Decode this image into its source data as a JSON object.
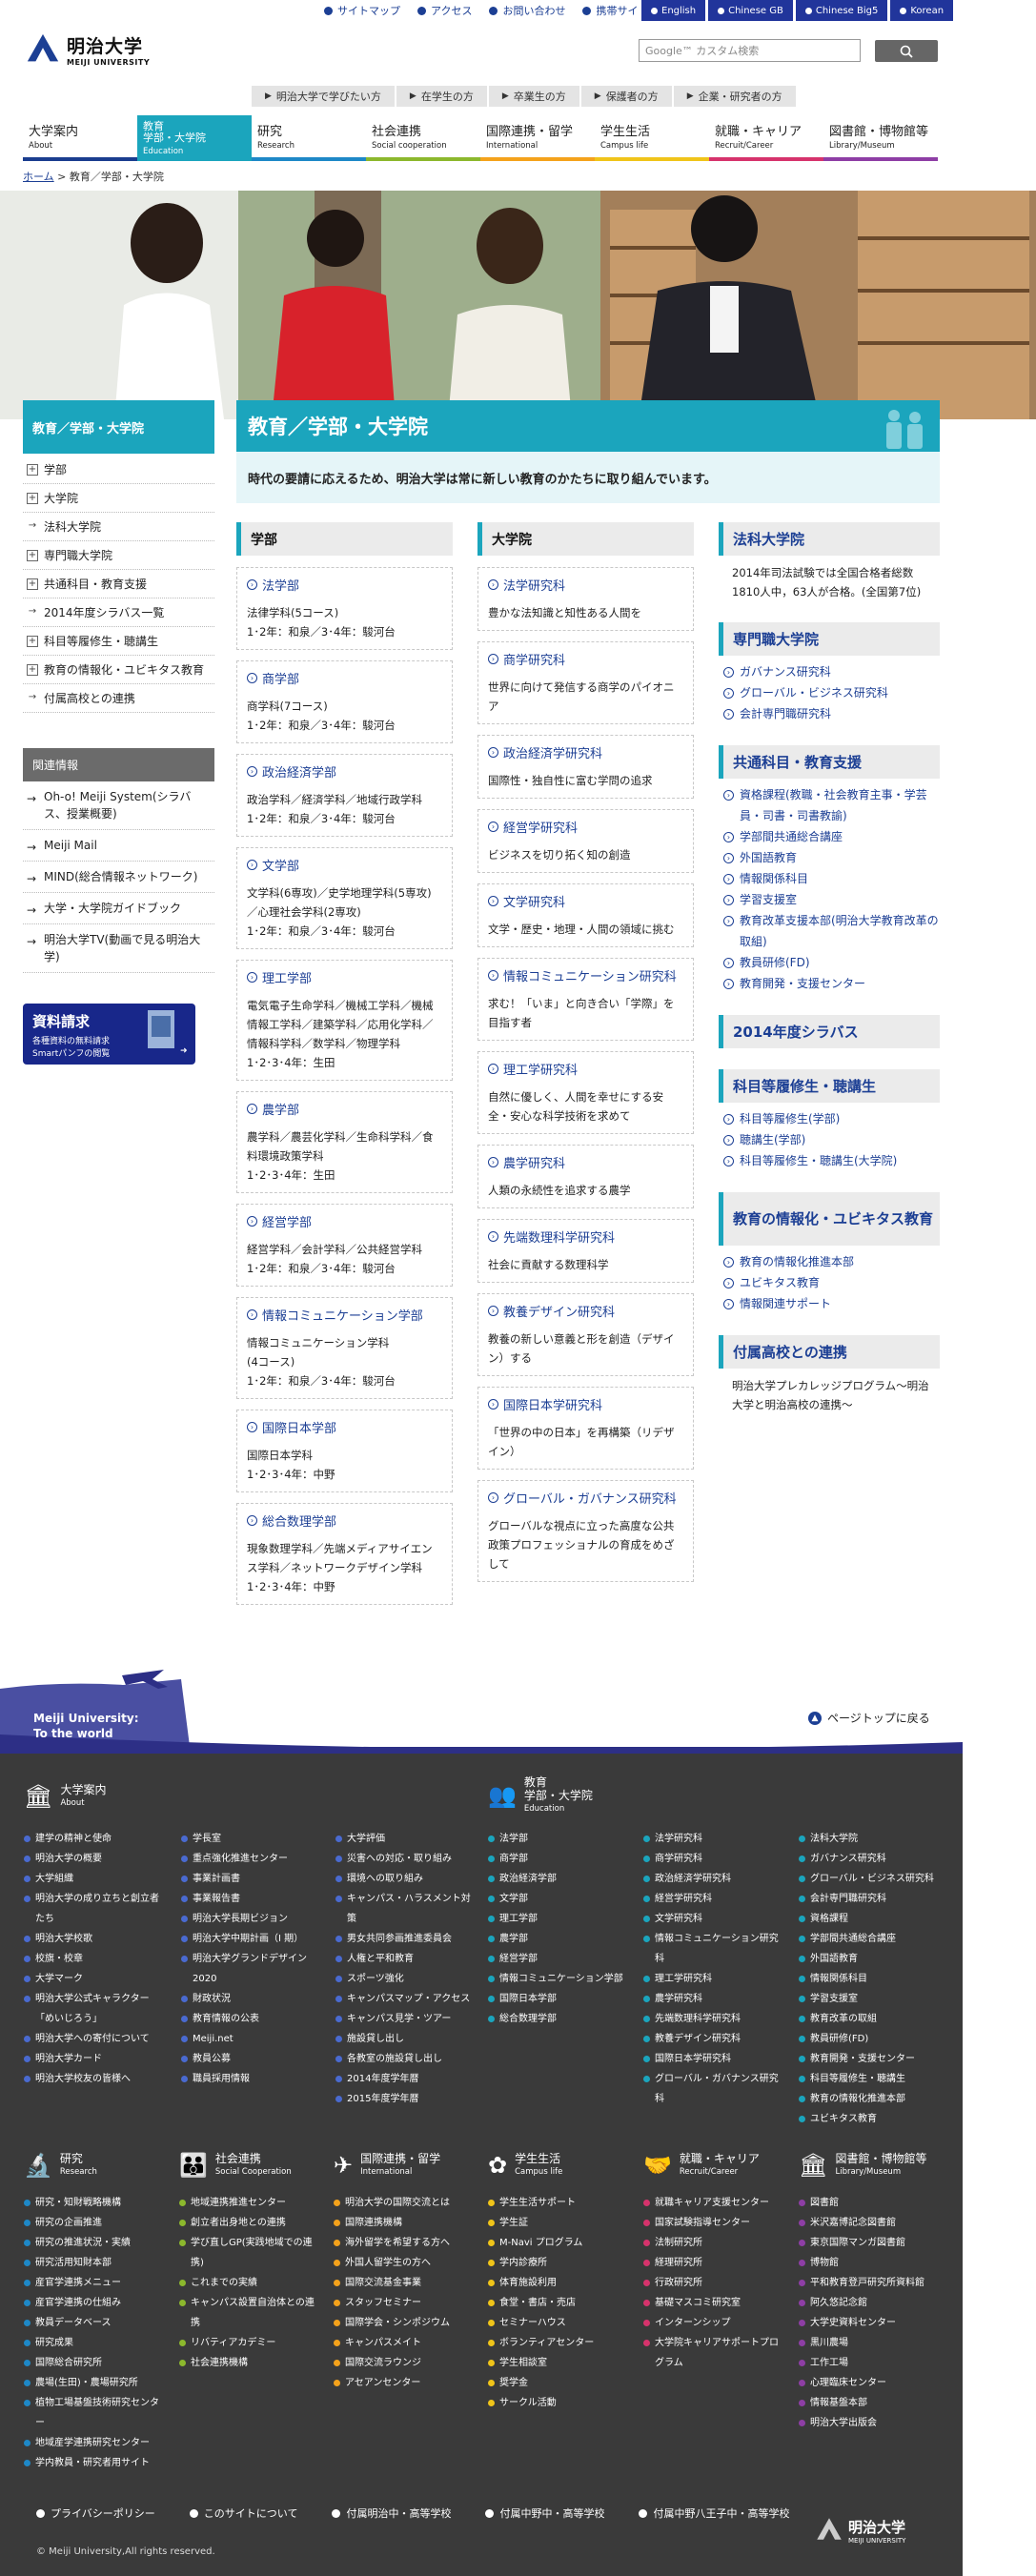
{
  "topbar": {
    "links": [
      "サイトマップ",
      "アクセス",
      "お問い合わせ",
      "携帯サイト"
    ],
    "langs": [
      "English",
      "Chinese GB",
      "Chinese Big5",
      "Korean"
    ]
  },
  "logo": {
    "ja": "明治大学",
    "en": "MEIJI UNIVERSITY"
  },
  "search": {
    "placeholder": "Google™ カスタム検索",
    "button": "検索"
  },
  "audience": [
    "明治大学で学びたい方",
    "在学生の方",
    "卒業生の方",
    "保護者の方",
    "企業・研究者の方"
  ],
  "gnav": [
    {
      "ja": "大学案内",
      "en": "About",
      "color": "#1a3d8f"
    },
    {
      "ja": "教育\n学部・大学院",
      "en": "Education",
      "color": "#1ba5bd"
    },
    {
      "ja": "研究",
      "en": "Research",
      "color": "#1e88c7"
    },
    {
      "ja": "社会連携",
      "en": "Social cooperation",
      "color": "#8cb82d"
    },
    {
      "ja": "国際連携・留学",
      "en": "International",
      "color": "#f4a21b"
    },
    {
      "ja": "学生生活",
      "en": "Campus life",
      "color": "#f0c419"
    },
    {
      "ja": "就職・キャリア",
      "en": "Recruit/Career",
      "color": "#d6336c"
    },
    {
      "ja": "図書館・博物館等",
      "en": "Library/Museum",
      "color": "#8e3ea5"
    }
  ],
  "breadcrumb": {
    "home": "ホーム",
    "current": "教育／学部・大学院"
  },
  "sidebar": {
    "title": "教育／学部・大学院",
    "items": [
      {
        "label": "学部",
        "icon": "plus"
      },
      {
        "label": "大学院",
        "icon": "plus"
      },
      {
        "label": "法科大学院",
        "icon": "arrow"
      },
      {
        "label": "専門職大学院",
        "icon": "plus"
      },
      {
        "label": "共通科目・教育支援",
        "icon": "plus"
      },
      {
        "label": "2014年度シラバス一覧",
        "icon": "arrow"
      },
      {
        "label": "科目等履修生・聴講生",
        "icon": "plus"
      },
      {
        "label": "教育の情報化・ユビキタス教育",
        "icon": "plus"
      },
      {
        "label": "付属高校との連携",
        "icon": "arrow"
      }
    ],
    "related_title": "関連情報",
    "related": [
      "Oh-o! Meiji System(シラバス、授業概要)",
      "Meiji Mail",
      "MIND(総合情報ネットワーク)",
      "大学・大学院ガイドブック",
      "明治大学TV(動画で見る明治大学)"
    ],
    "banner": {
      "title": "資料請求",
      "line1": "各種資料の無料請求",
      "line2": "Smartパンフの閲覧"
    }
  },
  "main": {
    "title": "教育／学部・大学院",
    "intro": "時代の要請に応えるため、明治大学は常に新しい教育のかたちに取り組んでいます。"
  },
  "faculties": {
    "heading": "学部",
    "items": [
      {
        "title": "法学部",
        "desc": "法律学科(5コース)\n1･2年：和泉／3･4年：駿河台"
      },
      {
        "title": "商学部",
        "desc": "商学科(7コース)\n1･2年：和泉／3･4年：駿河台"
      },
      {
        "title": "政治経済学部",
        "desc": "政治学科／経済学科／地域行政学科\n1･2年：和泉／3･4年：駿河台"
      },
      {
        "title": "文学部",
        "desc": "文学科(6専攻)／史学地理学科(5専攻)／心理社会学科(2専攻)\n1･2年：和泉／3･4年：駿河台"
      },
      {
        "title": "理工学部",
        "desc": "電気電子生命学科／機械工学科／機械情報工学科／建築学科／応用化学科／情報科学科／数学科／物理学科\n1･2･3･4年：生田"
      },
      {
        "title": "農学部",
        "desc": "農学科／農芸化学科／生命科学科／食料環境政策学科\n1･2･3･4年：生田"
      },
      {
        "title": "経営学部",
        "desc": "経営学科／会計学科／公共経営学科\n1･2年：和泉／3･4年：駿河台"
      },
      {
        "title": "情報コミュニケーション学部",
        "desc": "情報コミュニケーション学科\n(4コース)\n1･2年：和泉／3･4年：駿河台"
      },
      {
        "title": "国際日本学部",
        "desc": "国際日本学科\n1･2･3･4年：中野"
      },
      {
        "title": "総合数理学部",
        "desc": "現象数理学科／先端メディアサイエンス学科／ネットワークデザイン学科\n1･2･3･4年：中野"
      }
    ]
  },
  "graduate": {
    "heading": "大学院",
    "items": [
      {
        "title": "法学研究科",
        "desc": "豊かな法知識と知性ある人間を"
      },
      {
        "title": "商学研究科",
        "desc": "世界に向けて発信する商学のパイオニア"
      },
      {
        "title": "政治経済学研究科",
        "desc": "国際性・独自性に富む学問の追求"
      },
      {
        "title": "経営学研究科",
        "desc": "ビジネスを切り拓く知の創造"
      },
      {
        "title": "文学研究科",
        "desc": "文学・歴史・地理・人間の領域に挑む"
      },
      {
        "title": "情報コミュニケーション研究科",
        "desc": "求む！「いま」と向き合い「学際」を目指す者"
      },
      {
        "title": "理工学研究科",
        "desc": "自然に優しく、人間を幸せにする安全・安心な科学技術を求めて"
      },
      {
        "title": "農学研究科",
        "desc": "人類の永続性を追求する農学"
      },
      {
        "title": "先端数理科学研究科",
        "desc": "社会に貢献する数理科学"
      },
      {
        "title": "教養デザイン研究科",
        "desc": "教養の新しい意義と形を創造（デザイン）する"
      },
      {
        "title": "国際日本学研究科",
        "desc": "「世界の中の日本」を再構築（リデザイン）"
      },
      {
        "title": "グローバル・ガバナンス研究科",
        "desc": "グローバルな視点に立った高度な公共政策プロフェッショナルの育成をめざして"
      }
    ]
  },
  "right": [
    {
      "heading": "法科大学院",
      "text": "2014年司法試験では全国合格者総数1810人中，63人が合格。(全国第7位)"
    },
    {
      "heading": "専門職大学院",
      "links": [
        "ガバナンス研究科",
        "グローバル・ビジネス研究科",
        "会計専門職研究科"
      ]
    },
    {
      "heading": "共通科目・教育支援",
      "links": [
        "資格課程(教職・社会教育主事・学芸員・司書・司書教諭)",
        "学部間共通総合講座",
        "外国語教育",
        "情報関係科目",
        "学習支援室",
        "教育改革支援本部(明治大学教育改革の取組)",
        "教員研修(FD)",
        "教育開発・支援センター"
      ]
    },
    {
      "heading": "2014年度シラバス"
    },
    {
      "heading": "科目等履修生・聴講生",
      "links": [
        "科目等履修生(学部)",
        "聴講生(学部)",
        "科目等履修生・聴講生(大学院)"
      ]
    },
    {
      "heading": "教育の情報化・ユビキタス教育",
      "links": [
        "教育の情報化推進本部",
        "ユビキタス教育",
        "情報関連サポート"
      ]
    },
    {
      "heading": "付属高校との連携",
      "text": "明治大学プレカレッジプログラム～明治大学と明治高校の連携～"
    }
  ],
  "world": {
    "line1": "Meiji University:",
    "line2": "To the world"
  },
  "pagetop": "ページトップに戻る",
  "footer": {
    "about": {
      "ja": "大学案内",
      "en": "About",
      "col1": [
        "建学の精神と使命",
        "明治大学の概要",
        "大学組織",
        "明治大学の成り立ちと創立者たち",
        "明治大学校歌",
        "校旗・校章",
        "大学マーク",
        "明治大学公式キャラクター「めいじろう」",
        "明治大学への寄付について",
        "明治大学カード",
        "明治大学校友の皆様へ"
      ],
      "col2": [
        "学長室",
        "重点強化推進センター",
        "事業計画書",
        "事業報告書",
        "明治大学長期ビジョン",
        "明治大学中期計画（I 期）",
        "明治大学グランドデザイン2020",
        "財政状況",
        "教育情報の公表",
        "Meiji.net",
        "教員公募",
        "職員採用情報"
      ],
      "col3": [
        "大学評価",
        "災害への対応・取り組み",
        "環境への取り組み",
        "キャンパス・ハラスメント対策",
        "男女共同参画推進委員会",
        "人権と平和教育",
        "スポーツ強化",
        "キャンパスマップ・アクセス",
        "キャンパス見学・ツアー",
        "施設貸し出し",
        "各教室の施設貸し出し",
        "2014年度学年暦",
        "2015年度学年暦"
      ]
    },
    "education": {
      "ja": "教育\n学部・大学院",
      "en": "Education",
      "col1": [
        "法学部",
        "商学部",
        "政治経済学部",
        "文学部",
        "理工学部",
        "農学部",
        "経営学部",
        "情報コミュニケーション学部",
        "国際日本学部",
        "総合数理学部"
      ],
      "col2": [
        "法学研究科",
        "商学研究科",
        "政治経済学研究科",
        "経営学研究科",
        "文学研究科",
        "情報コミュニケーション研究科",
        "理工学研究科",
        "農学研究科",
        "先端数理科学研究科",
        "教養デザイン研究科",
        "国際日本学研究科",
        "グローバル・ガバナンス研究科"
      ],
      "col3": [
        "法科大学院",
        "ガバナンス研究科",
        "グローバル・ビジネス研究科",
        "会計専門職研究科",
        "資格課程",
        "学部間共通総合講座",
        "外国語教育",
        "情報関係科目",
        "学習支援室",
        "教育改革の取組",
        "教員研修(FD)",
        "教育開発・支援センター",
        "科目等履修生・聴講生",
        "教育の情報化推進本部",
        "ユビキタス教育"
      ]
    },
    "research": {
      "ja": "研究",
      "en": "Research",
      "items": [
        "研究・知財戦略機構",
        "研究の企画推進",
        "研究の推進状況・実績",
        "研究活用知財本部",
        "産官学連携メニュー",
        "産官学連携の仕組み",
        "教員データベース",
        "研究成果",
        "国際総合研究所",
        "農場(生田)・農場研究所",
        "植物工場基盤技術研究センター",
        "地域産学連携研究センター",
        "学内教員・研究者用サイト"
      ]
    },
    "social": {
      "ja": "社会連携",
      "en": "Social Cooperation",
      "items": [
        "地域連携推進センター",
        "創立者出身地との連携",
        "学び直しGP(実践地域での連携)",
        "これまでの実績",
        "キャンパス設置自治体との連携",
        "リバティアカデミー",
        "社会連携機構"
      ]
    },
    "intl": {
      "ja": "国際連携・留学",
      "en": "International",
      "items": [
        "明治大学の国際交流とは",
        "国際連携機構",
        "海外留学を希望する方へ",
        "外国人留学生の方へ",
        "国際交流基金事業",
        "スタッフセミナー",
        "国際学会・シンポジウム",
        "キャンパスメイト",
        "国際交流ラウンジ",
        "アセアンセンター"
      ]
    },
    "campus": {
      "ja": "学生生活",
      "en": "Campus life",
      "items": [
        "学生生活サポート",
        "学生証",
        "M-Navi プログラム",
        "学内診療所",
        "体育施設利用",
        "食堂・書店・売店",
        "セミナーハウス",
        "ボランティアセンター",
        "学生相談室",
        "奨学金",
        "サークル活動"
      ]
    },
    "career": {
      "ja": "就職・キャリア",
      "en": "Recruit/Career",
      "items": [
        "就職キャリア支援センター",
        "国家試験指導センター",
        "法制研究所",
        "経理研究所",
        "行政研究所",
        "基礎マスコミ研究室",
        "インターンシップ",
        "大学院キャリアサポートプログラム"
      ]
    },
    "library": {
      "ja": "図書館・博物館等",
      "en": "Library/Museum",
      "items": [
        "図書館",
        "米沢嘉博記念図書館",
        "東京国際マンガ図書館",
        "博物館",
        "平和教育登戸研究所資料館",
        "阿久悠記念館",
        "大学史資料センター",
        "黒川農場",
        "工作工場",
        "心理臨床センター",
        "情報基盤本部",
        "明治大学出版会"
      ]
    },
    "bottom": [
      "プライバシーポリシー",
      "このサイトについて",
      "付属明治中・高等学校",
      "付属中野中・高等学校",
      "付属中野八王子中・高等学校"
    ],
    "copyright": "© Meiji University,All rights reserved."
  }
}
